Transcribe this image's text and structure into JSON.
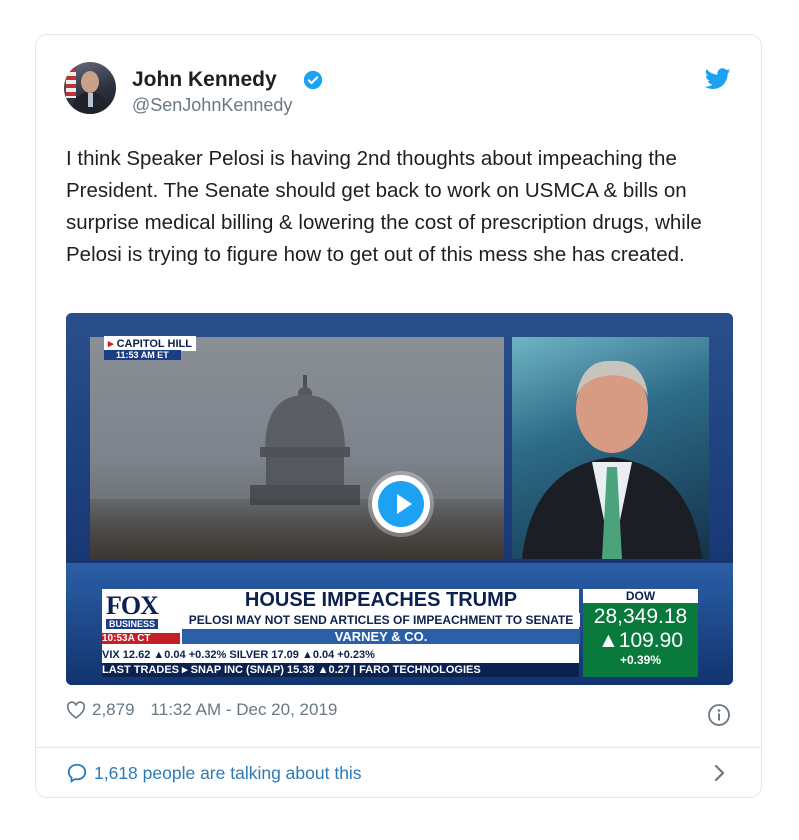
{
  "author": {
    "name": "John Kennedy",
    "handle": "@SenJohnKennedy"
  },
  "tweet_text": "I think Speaker Pelosi is having 2nd thoughts about impeaching the President. The Senate should get back to work on USMCA & bills on surprise medical billing & lowering the cost of prescription drugs, while Pelosi is trying to figure how to get out of this mess she has created.",
  "video": {
    "location_label": "CAPITOL HILL",
    "location_time": "11:53 AM ET",
    "network": "FOX",
    "network_sub": "BUSINESS",
    "headline": "HOUSE IMPEACHES TRUMP",
    "subheadline": "PELOSI MAY NOT SEND ARTICLES OF IMPEACHMENT TO SENATE",
    "show": "VARNEY & CO.",
    "clock": "10:53A CT",
    "vix_row": "VIX   12.62 ▲0.04 +0.32%  SILVER   17.09 ▲0.04 +0.23%",
    "last_trades_row": "LAST TRADES ▸  SNAP INC (SNAP) 15.38 ▲0.27 | FARO TECHNOLOGIES",
    "dow_label": "DOW",
    "dow_value": "28,349.18",
    "dow_change": "▲109.90",
    "dow_pct": "+0.39%"
  },
  "meta": {
    "likes": "2,879",
    "timestamp": "11:32 AM - Dec 20, 2019"
  },
  "footer": {
    "talk_label": "1,618 people are talking about this"
  },
  "colors": {
    "link_blue": "#2b7bb9",
    "twitter_blue": "#1da1f2",
    "text_gray": "#697882"
  }
}
